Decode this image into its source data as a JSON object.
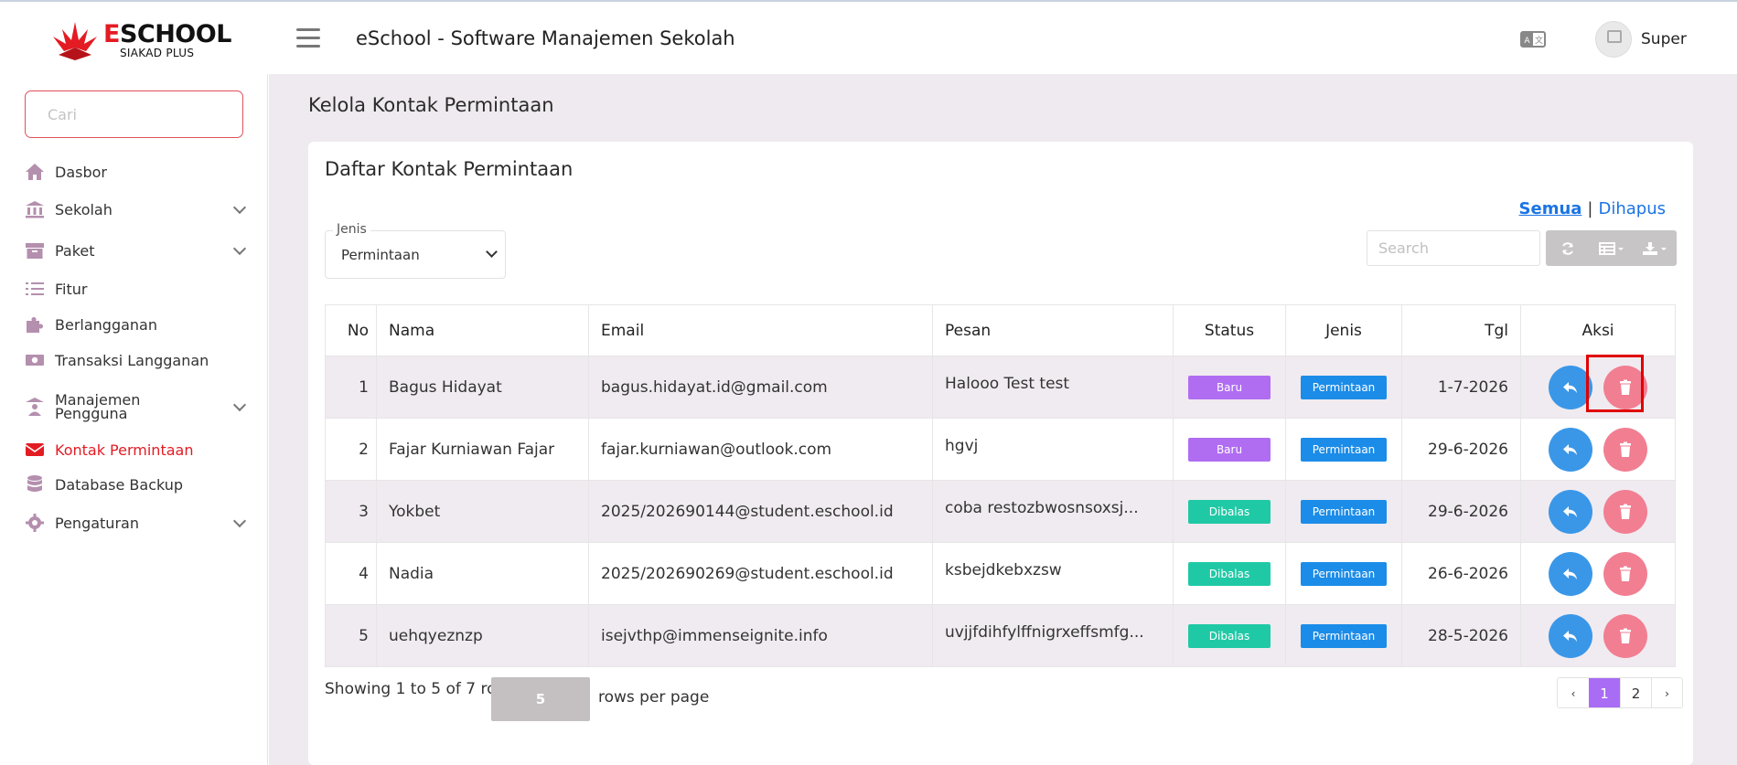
{
  "header": {
    "logo_title": "ESCHOOL",
    "logo_subtitle": "SIAKAD PLUS",
    "app_title": "eSchool - Software Manajemen Sekolah",
    "user_name": "Super"
  },
  "sidebar": {
    "search_placeholder": "Cari",
    "items": [
      {
        "label": "Dasbor",
        "icon": "home-icon"
      },
      {
        "label": "Sekolah",
        "icon": "bank-icon"
      },
      {
        "label": "Paket",
        "icon": "archive-icon"
      },
      {
        "label": "Fitur",
        "icon": "list-icon"
      },
      {
        "label": "Berlangganan",
        "icon": "puzzle-icon"
      },
      {
        "label": "Transaksi Langganan",
        "icon": "money-icon"
      },
      {
        "label": "Manajemen Pengguna",
        "icon": "users-icon"
      },
      {
        "label": "Kontak Permintaan",
        "icon": "envelope-icon"
      },
      {
        "label": "Database Backup",
        "icon": "database-icon"
      },
      {
        "label": "Pengaturan",
        "icon": "gear-icon"
      }
    ]
  },
  "main": {
    "page_title": "Kelola Kontak Permintaan",
    "card_title": "Daftar Kontak Permintaan",
    "filter_all": "Semua",
    "filter_separator": "|",
    "filter_deleted": "Dihapus",
    "jenis_label": "Jenis",
    "jenis_value": "Permintaan",
    "search_placeholder": "Search",
    "columns": [
      "No",
      "Nama",
      "Email",
      "Pesan",
      "Status",
      "Jenis",
      "Tgl",
      "Aksi"
    ],
    "rows": [
      {
        "no": "1",
        "nama": "Bagus Hidayat",
        "email": "bagus.hidayat.id@gmail.com",
        "pesan": "Halooo Test test",
        "status": "Baru",
        "jenis": "Permintaan",
        "tgl": "1-7-2026"
      },
      {
        "no": "2",
        "nama": "Fajar Kurniawan Fajar",
        "email": "fajar.kurniawan@outlook.com",
        "pesan": "hgvj",
        "status": "Baru",
        "jenis": "Permintaan",
        "tgl": "29-6-2026"
      },
      {
        "no": "3",
        "nama": "Yokbet",
        "email": "2025/202690144@student.eschool.id",
        "pesan": "coba restozbwosnsoxsj...",
        "status": "Dibalas",
        "jenis": "Permintaan",
        "tgl": "29-6-2026"
      },
      {
        "no": "4",
        "nama": "Nadia",
        "email": "2025/202690269@student.eschool.id",
        "pesan": "ksbejdkebxzsw",
        "status": "Dibalas",
        "jenis": "Permintaan",
        "tgl": "26-6-2026"
      },
      {
        "no": "5",
        "nama": "uehqyeznzp",
        "email": "isejvthp@immenseignite.info",
        "pesan": "uvjjfdihfylffnigrxeffsmfg...",
        "status": "Dibalas",
        "jenis": "Permintaan",
        "tgl": "28-5-2026"
      }
    ],
    "showing_text": "Showing 1 to 5 of 7 rows",
    "page_size": "5",
    "per_page_text": "rows per page",
    "pager": {
      "prev": "‹",
      "pages": [
        "1",
        "2"
      ],
      "next": "›",
      "active": "1"
    }
  },
  "colors": {
    "brand_red": "#e31b23",
    "status_baru": "#b06df2",
    "status_dibalas": "#20c9a6",
    "jenis_badge": "#1b8ce8",
    "reply_button": "#3a97e8",
    "delete_button": "#f27e92",
    "active_page": "#a96cf5",
    "highlight_box": "#e00000"
  }
}
